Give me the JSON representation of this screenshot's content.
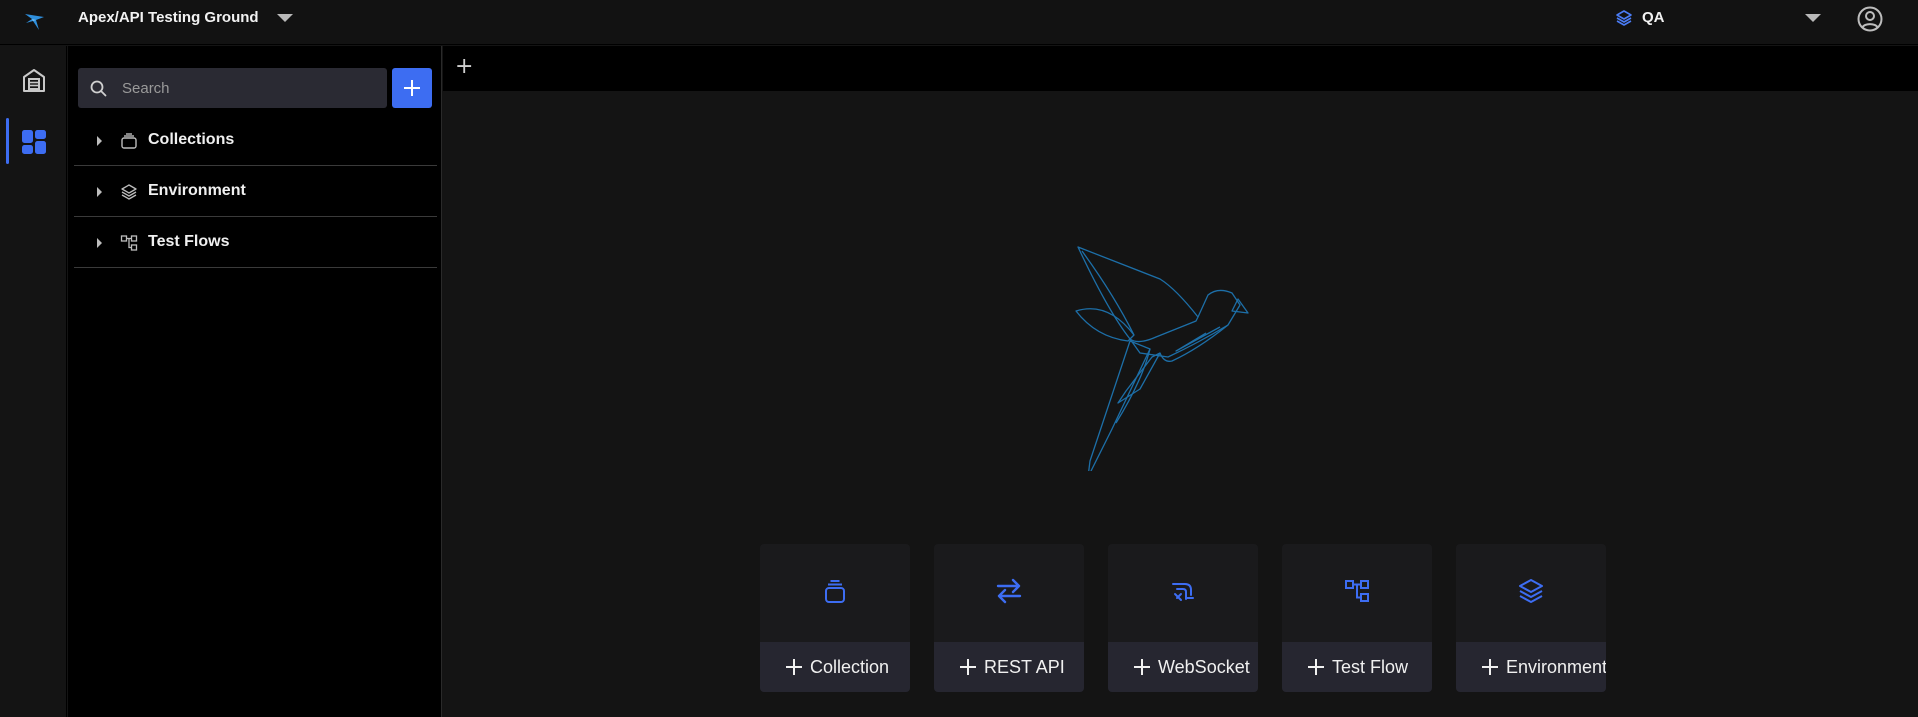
{
  "app": {
    "workspace_title": "Apex/API Testing Ground",
    "environment": "QA"
  },
  "rail": {
    "items": [
      {
        "name": "home",
        "active": false
      },
      {
        "name": "workspace",
        "active": true
      }
    ]
  },
  "sidebar": {
    "search_placeholder": "Search",
    "tree": [
      {
        "label": "Collections",
        "icon": "collection-icon"
      },
      {
        "label": "Environment",
        "icon": "layers-icon"
      },
      {
        "label": "Test Flows",
        "icon": "flow-icon"
      }
    ]
  },
  "tabs": {
    "add_label": "+"
  },
  "quick_create": [
    {
      "label": "Collection",
      "icon": "collection-icon"
    },
    {
      "label": "REST API",
      "icon": "arrows-exchange-icon"
    },
    {
      "label": "WebSocket",
      "icon": "websocket-icon"
    },
    {
      "label": "Test Flow",
      "icon": "flow-icon"
    },
    {
      "label": "Environment",
      "icon": "layers-icon"
    }
  ],
  "colors": {
    "accent": "#3d6df2",
    "logo": "#2f8fdc",
    "bird_outline": "#1d6fa8"
  }
}
